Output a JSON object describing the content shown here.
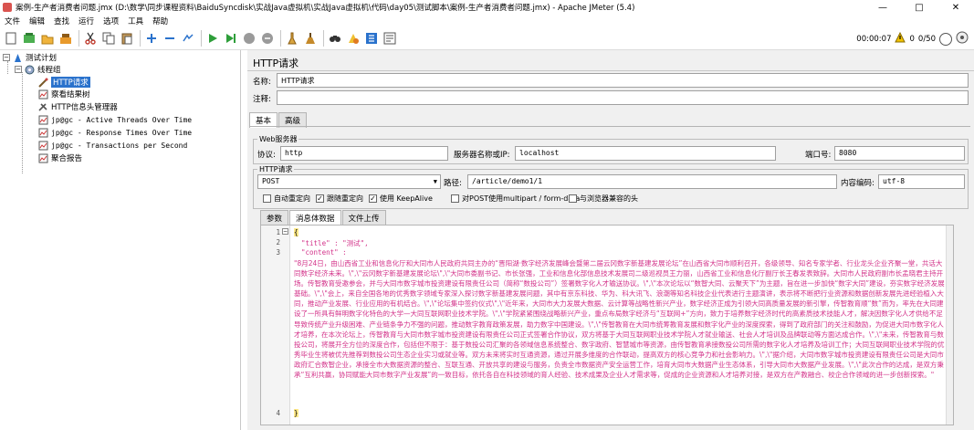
{
  "window": {
    "title": "案例-生产者消费者问题.jmx (D:\\数学\\同步课程资料\\BaiduSyncdisk\\实战Java虚拟机\\实战Java虚拟机\\代码\\day05\\测试脚本\\案例-生产者消费者问题.jmx) - Apache JMeter (5.4)",
    "minimize": "—",
    "maximize": "□",
    "close": "✕"
  },
  "menu": [
    "文件",
    "编辑",
    "查找",
    "运行",
    "选项",
    "工具",
    "帮助"
  ],
  "toolbar": {
    "timer": "00:00:07",
    "warning_count": "0",
    "threads": "0/50"
  },
  "tree": {
    "items": [
      {
        "label": "测试计划"
      },
      {
        "label": "线程组"
      },
      {
        "label": "HTTP请求"
      },
      {
        "label": "察看结果树"
      },
      {
        "label": "HTTP信息头管理器"
      },
      {
        "label": "jp@gc - Active Threads Over Time"
      },
      {
        "label": "jp@gc - Response Times Over Time"
      },
      {
        "label": "jp@gc - Transactions per Second"
      },
      {
        "label": "聚合报告"
      }
    ]
  },
  "panel": {
    "heading": "HTTP请求",
    "name_label": "名称:",
    "name_value": "HTTP请求",
    "comment_label": "注释:",
    "tabs": [
      "基本",
      "高级"
    ],
    "web_server_legend": "Web服务器",
    "protocol_label": "协议:",
    "protocol_value": "http",
    "server_label": "服务器名称或IP:",
    "server_value": "localhost",
    "port_label": "端口号:",
    "port_value": "8080",
    "http_request_legend": "HTTP请求",
    "method": "POST",
    "path_label": "路径:",
    "path_value": "/article/demo1/1",
    "encoding_label": "内容编码:",
    "encoding_value": "utf-8",
    "checkboxes": [
      {
        "label": "自动重定向",
        "checked": false
      },
      {
        "label": "跟随重定向",
        "checked": true
      },
      {
        "label": "使用 KeepAlive",
        "checked": true
      },
      {
        "label": "对POST使用multipart / form-data",
        "checked": false
      },
      {
        "label": "与浏览器兼容的头",
        "checked": false
      }
    ],
    "sub_tabs": [
      "参数",
      "消息体数据",
      "文件上传"
    ]
  },
  "editor": {
    "line_numbers": [
      "1",
      "2",
      "3",
      "4"
    ],
    "line1": "{",
    "line2": "\"title\" : \"测试\",",
    "line3": "\"content\" :",
    "content": "\"8月24日，由山西省工业和信息化厅和大同市人民政府共同主办的“晋阳湖·数字经济发展峰会暨第二届云冈数字新基建发展论坛”在山西省大同市顺利召开，各级领导、知名专家学者、行业龙头企业齐聚一堂，共话大同数字经济未来。\\\",\\\"云冈数字新基建发展论坛\\\",\\\"大同市委副书记、市长张强，工业和信息化部信息技术发展司二级巡视员王力丽，山西省工业和信息化厅副厅长王春发表致辞。大同市人民政府副市长孟晓君主持开场。传智教育受邀参会，并与大同市数字城市投资建设有限责任公司（简称“数投公司”）签署数字化人才输送协议。\\\",\\\"本次论坛以“数智大同、云聚天下”为主题，旨在进一步加快“数字大同”建设，夯实数字经济发展基础。\\\",\\\"会上，来自全国各地的优秀数字领域专家深入探讨数字新基建发展问题，其中有京东科技、华为、科大讯飞、浪潮等知名科技企业代表进行主题演讲，表示将不断把行业资源和数据创新发展先进经验植入大同，推动产业发展、行业应用的有机结合。\\\",\\\"论坛集中签约仪式\\\",\\\"近年来，大同市大力发展大数据、云计算等战略性新兴产业，数字经济正成为引领大同高质量发展的新引擎，传智教育顺“数”而为，率先在大同建设了一所具有鲜明数字化特色的大学—大同互联网职业技术学院。\\\",\\\"学院紧紧围绕战略新兴产业，重点布局数字经济与“互联网+”方向，致力于培养数字经济时代的高素质技术技能人才，解决因数字化人才供给不足导致传统产业升级困难、产业链条争力不强的问题，推动数字教育政策发展，助力数字中国建设。\\\",\\\"传智教育在大同市统筹教育发展和数字化产业的深度探索，得到了政府部门的关注和鼓励，为促进大同市数字化人才培养，在本次论坛上，传智教育与大同市数字城市投资建设有限责任公司正式签署合作协议，双方将基于大同互联网职业技术学院人才就业输送、社会人才培训及品牌联动等方面达成合作。\\\",\\\"未来，传智教育与数投公司，将展开全方位的深度合作，包括但不限于：基于数投公司汇聚的各领域信息系统整合、数字政府、智慧城市等资源，由传智教育承接数投公司所需的数字化人才培养及培训工作；大同互联网职业技术学院的优秀毕业生将被优先推荐到数投公司生态企业实习或就业等。双方未来将实时互通资源，通过开展多维度的合作联动，提高双方的核心竞争力和社会影响力。\\\",\\\"据介绍，大同市数字城市投资建设有限责任公司是大同市政府汇合数智企业，承接全市大数据资源的整合、互联互通、开放共享的建设与服务，负责全市数据资产安全运营工作，培育大同市大数据产业生态体系，引导大同市大数据产业发展。\\\",\\\"此次合作的达成，是双方秉承“互利共赢，协同赋能大同市数字产业发展”的一致目标，依托各自在科技领域的育人经验、技术成果及企业人才需求等，促成的企业资源和人才培养对接，是双方在产教融合、校企合作领域的进一步创新探索。\"",
    "line4": "}"
  }
}
